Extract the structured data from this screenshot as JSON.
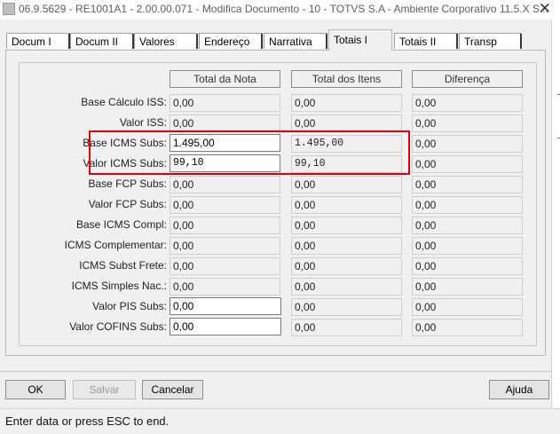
{
  "window": {
    "title": "06.9.5629 - RE1001A1 - 2.00.00.071 - Modifica Documento - 10 - TOTVS S.A - Ambiente Corporativo 11.5.X S...",
    "close_glyph": "✕"
  },
  "tabs": [
    {
      "label": "Docum I",
      "active": false
    },
    {
      "label": "Docum II",
      "active": false
    },
    {
      "label": "Valores",
      "active": false
    },
    {
      "label": "Endereço",
      "active": false
    },
    {
      "label": "Narrativa",
      "active": false
    },
    {
      "label": "Totais I",
      "active": true
    },
    {
      "label": "Totais II",
      "active": false
    },
    {
      "label": "Transp",
      "active": false
    }
  ],
  "columns": [
    "Total da Nota",
    "Total dos Itens",
    "Diferença"
  ],
  "rows": [
    {
      "label": "Base Cálculo ISS:",
      "nota": "0,00",
      "itens": "0,00",
      "diferenca": "0,00"
    },
    {
      "label": "Valor ISS:",
      "nota": "0,00",
      "itens": "0,00",
      "diferenca": "0,00"
    },
    {
      "label": "Base ICMS Subs:",
      "nota": "1.495,00",
      "itens": "1.495,00",
      "diferenca": "0,00"
    },
    {
      "label": "Valor ICMS Subs:",
      "nota": "99,10",
      "itens": "99,10",
      "diferenca": "0,00"
    },
    {
      "label": "Base FCP Subs:",
      "nota": "0,00",
      "itens": "0,00",
      "diferenca": "0,00"
    },
    {
      "label": "Valor FCP Subs:",
      "nota": "0,00",
      "itens": "0,00",
      "diferenca": "0,00"
    },
    {
      "label": "Base ICMS Compl:",
      "nota": "0,00",
      "itens": "0,00",
      "diferenca": "0,00"
    },
    {
      "label": "ICMS Complementar:",
      "nota": "0,00",
      "itens": "0,00",
      "diferenca": "0,00"
    },
    {
      "label": "ICMS Subst Frete:",
      "nota": "0,00",
      "itens": "0,00",
      "diferenca": "0,00"
    },
    {
      "label": "ICMS Simples Nac.:",
      "nota": "0,00",
      "itens": "0,00",
      "diferenca": "0,00"
    },
    {
      "label": "Valor PIS Subs:",
      "nota": "0,00",
      "itens": "0,00",
      "diferenca": "0,00"
    },
    {
      "label": "Valor COFINS Subs:",
      "nota": "0,00",
      "itens": "0,00",
      "diferenca": "0,00"
    }
  ],
  "buttons": {
    "ok": "OK",
    "salvar": "Salvar",
    "cancelar": "Cancelar",
    "ajuda": "Ajuda"
  },
  "status": "Enter data or press ESC to end.",
  "colors": {
    "highlight_border": "#e00000",
    "dialog_bg": "#f0f0f0"
  }
}
